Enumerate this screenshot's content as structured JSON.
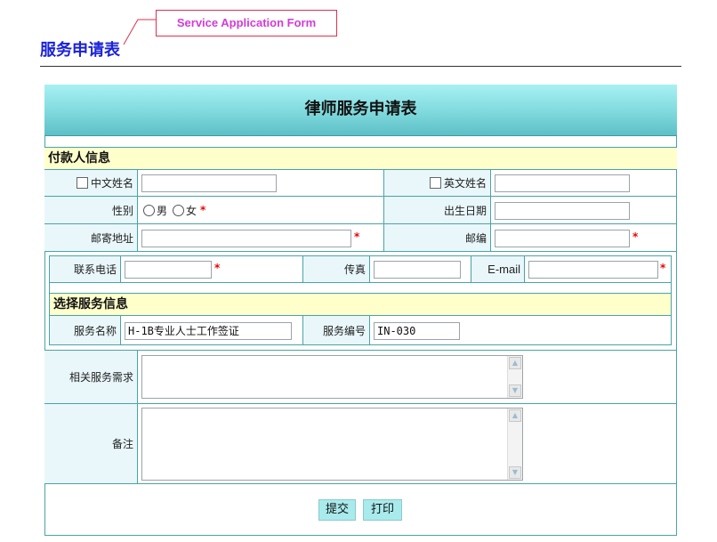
{
  "callout": {
    "label": "Service Application Form"
  },
  "page": {
    "title": "服务申请表"
  },
  "form": {
    "title": "律师服务申请表",
    "payer_section": "付款人信息",
    "service_section": "选择服务信息",
    "fields": {
      "chinese_name": {
        "label": "中文姓名",
        "value": ""
      },
      "english_name": {
        "label": "英文姓名",
        "value": ""
      },
      "gender": {
        "label": "性别",
        "options": [
          "男",
          "女"
        ]
      },
      "birth_date": {
        "label": "出生日期",
        "value": ""
      },
      "address": {
        "label": "邮寄地址",
        "value": ""
      },
      "postcode": {
        "label": "邮编",
        "value": ""
      },
      "phone": {
        "label": "联系电话",
        "value": ""
      },
      "fax": {
        "label": "传真",
        "value": ""
      },
      "email": {
        "label": "E-mail",
        "value": ""
      },
      "service_name": {
        "label": "服务名称",
        "value": "H-1B专业人士工作签证"
      },
      "service_code": {
        "label": "服务编号",
        "value": "IN-030"
      },
      "requirements": {
        "label": "相关服务需求",
        "value": ""
      },
      "remarks": {
        "label": "备注",
        "value": ""
      }
    },
    "required_mark": "*",
    "buttons": {
      "submit": "提交",
      "print": "打印"
    }
  },
  "colors": {
    "title_blue": "#1a22d8",
    "callout_text": "#d23bd8",
    "callout_border": "#e0304a",
    "header_teal": "#7fd9dd",
    "section_yellow": "#ffffcc",
    "label_bg": "#e9f7fb",
    "border_teal": "#4aa3a8",
    "button_bg": "#a9ebec",
    "required_red": "#ee0000"
  }
}
